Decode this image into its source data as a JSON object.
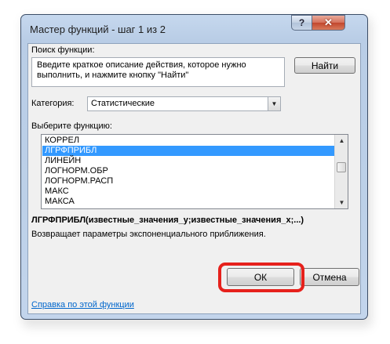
{
  "window": {
    "title": "Мастер функций - шаг 1 из 2",
    "help_glyph": "?",
    "close_glyph": "✕"
  },
  "search": {
    "label": "Поиск функции:",
    "description": "Введите краткое описание действия, которое нужно выполнить, и нажмите кнопку \"Найти\"",
    "find_button": "Найти"
  },
  "category": {
    "label": "Категория:",
    "value": "Статистические"
  },
  "functions": {
    "label": "Выберите функцию:",
    "items": [
      "КОРРЕЛ",
      "ЛГРФПРИБЛ",
      "ЛИНЕЙН",
      "ЛОГНОРМ.ОБР",
      "ЛОГНОРМ.РАСП",
      "МАКС",
      "МАКСА"
    ],
    "selected_index": 1
  },
  "details": {
    "syntax": "ЛГРФПРИБЛ(известные_значения_y;известные_значения_x;...)",
    "description": "Возвращает параметры экспоненциального приближения."
  },
  "footer": {
    "help_link": "Справка по этой функции",
    "ok_button": "ОК",
    "cancel_button": "Отмена"
  },
  "colors": {
    "selection": "#3399ff",
    "highlight": "#e6211c",
    "link": "#0066cc"
  }
}
